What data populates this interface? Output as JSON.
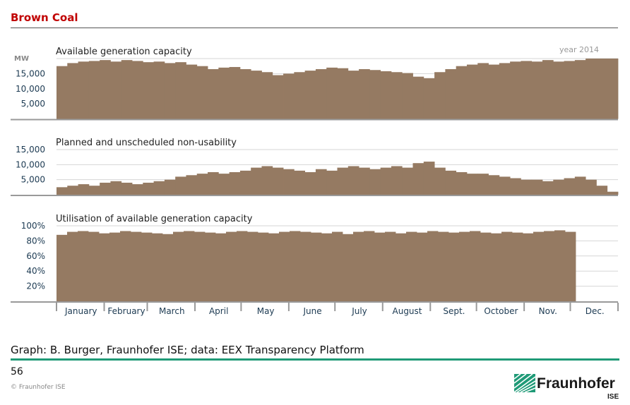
{
  "slide": {
    "title": "Brown Coal",
    "credit": "Graph: B. Burger, Fraunhofer ISE; data: EEX Transparency Platform",
    "page_number": "56",
    "copyright": "© Fraunhofer ISE",
    "logo": {
      "name": "Fraunhofer",
      "sub": "ISE"
    },
    "accent_color": "#1f9a77",
    "title_color": "#c00000"
  },
  "chart_data": [
    {
      "type": "area",
      "title": "Available generation capacity",
      "unit_label": "MW",
      "annotation": "year 2014",
      "ylim": [
        0,
        20000
      ],
      "yticks": [
        5000,
        10000,
        15000
      ],
      "ytick_labels": [
        "5,000",
        "10,000",
        "15,000"
      ],
      "grid": true,
      "x_unit": "week of 2014",
      "color": "#957a62",
      "values": [
        17500,
        18500,
        19000,
        19200,
        19500,
        19000,
        19500,
        19200,
        18800,
        19000,
        18500,
        18800,
        18000,
        17500,
        16500,
        17000,
        17200,
        16500,
        16000,
        15500,
        14500,
        15000,
        15500,
        16000,
        16500,
        17000,
        16800,
        16000,
        16500,
        16200,
        15800,
        15500,
        15200,
        14000,
        13500,
        15500,
        16500,
        17500,
        18000,
        18500,
        18000,
        18500,
        19000,
        19200,
        19000,
        19500,
        19000,
        19200,
        19500,
        20000,
        20000,
        20000
      ]
    },
    {
      "type": "area",
      "title": "Planned and unscheduled non-usability",
      "ylim": [
        0,
        15000
      ],
      "yticks": [
        5000,
        10000,
        15000
      ],
      "ytick_labels": [
        "5,000",
        "10,000",
        "15,000"
      ],
      "grid": true,
      "x_unit": "week of 2014",
      "color": "#957a62",
      "values": [
        2500,
        3000,
        3500,
        3000,
        4000,
        4500,
        4000,
        3500,
        4000,
        4500,
        5000,
        6000,
        6500,
        7000,
        7500,
        7000,
        7500,
        8000,
        9000,
        9500,
        9000,
        8500,
        8000,
        7500,
        8500,
        8000,
        9000,
        9500,
        9000,
        8500,
        9000,
        9500,
        9000,
        10500,
        11000,
        9000,
        8000,
        7500,
        7000,
        7000,
        6500,
        6000,
        5500,
        5000,
        5000,
        4500,
        5000,
        5500,
        6000,
        5000,
        3000,
        1000
      ]
    },
    {
      "type": "area",
      "title": "Utilisation of available generation capacity",
      "ylim": [
        0,
        100
      ],
      "yticks": [
        20,
        40,
        60,
        80,
        100
      ],
      "ytick_labels": [
        "20%",
        "40%",
        "60%",
        "80%",
        "100%"
      ],
      "grid": true,
      "x_unit": "week of 2014",
      "color": "#957a62",
      "values": [
        88,
        92,
        93,
        92,
        90,
        91,
        93,
        92,
        91,
        90,
        89,
        92,
        93,
        92,
        91,
        90,
        92,
        93,
        92,
        91,
        90,
        92,
        93,
        92,
        91,
        90,
        92,
        89,
        92,
        93,
        91,
        92,
        90,
        92,
        91,
        93,
        92,
        91,
        92,
        93,
        91,
        90,
        92,
        91,
        90,
        92,
        93,
        94,
        92,
        null,
        null,
        null,
        null
      ]
    }
  ],
  "x_axis": {
    "months": [
      "January",
      "February",
      "March",
      "April",
      "May",
      "June",
      "July",
      "August",
      "Sept.",
      "October",
      "Nov.",
      "Dec."
    ]
  }
}
